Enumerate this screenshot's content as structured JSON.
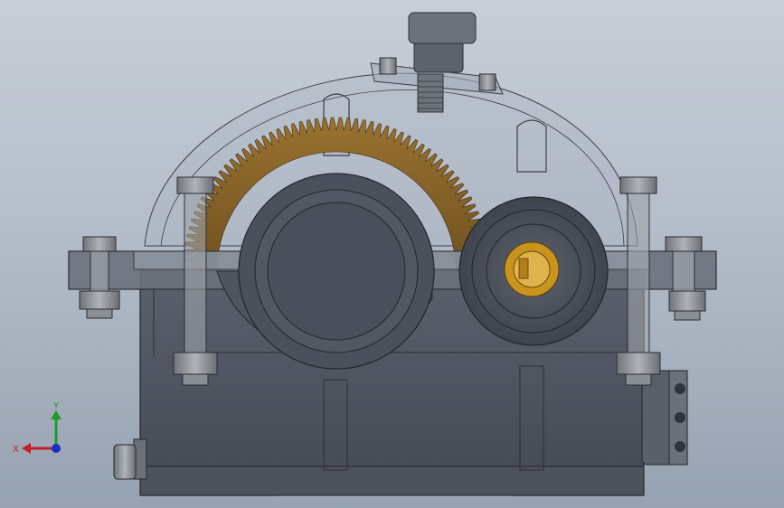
{
  "viewport": {
    "background_top": "#c7ced8",
    "background_bottom": "#97a2b1"
  },
  "model": {
    "housing_color": "#4a4f5a",
    "gear_color": "#8a6428",
    "shaft_key_color": "#c8941e",
    "bolt_color": "#8e9298"
  },
  "triad": {
    "x_label": "X",
    "y_label": "Y",
    "x_color": "#c0202a",
    "y_color": "#1f9a2a",
    "z_color": "#1a2fc0"
  }
}
